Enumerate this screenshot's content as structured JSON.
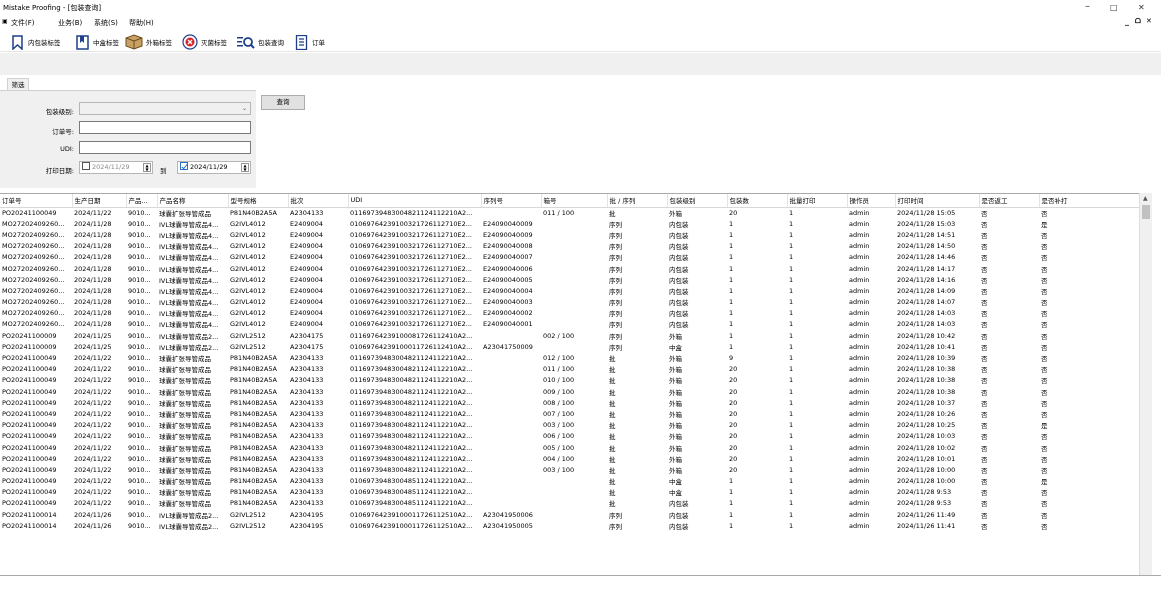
{
  "window": {
    "title": "Mistake Proofing - [包装查询]",
    "controls": [
      "–",
      "□",
      "✕"
    ],
    "mdi_controls": [
      "_",
      "ᗝ",
      "✕"
    ]
  },
  "menu": [
    "文件(F)",
    "业务(B)",
    "系统(S)",
    "帮助(H)"
  ],
  "toolbar": [
    {
      "label": "内包装标签",
      "icon": "bookmark-icon"
    },
    {
      "label": "中盒标签",
      "icon": "bookmark-filled-icon"
    },
    {
      "label": "外箱标签",
      "icon": "box-icon"
    },
    {
      "label": "灭菌标签",
      "icon": "sterilize-icon"
    },
    {
      "label": "包装查询",
      "icon": "search-icon"
    },
    {
      "label": "订单",
      "icon": "order-icon"
    }
  ],
  "filter": {
    "tab": "筛选",
    "level_label": "包装级别:",
    "level_value": "",
    "order_label": "订单号:",
    "order_value": "",
    "udi_label": "UDI:",
    "udi_value": "",
    "date_label": "打印日期:",
    "date_from": "2024/11/29",
    "date_to_sep": "到",
    "date_to": "2024/11/29",
    "query_button": "查询"
  },
  "columns": [
    "订单号",
    "生产日期",
    "产品...",
    "产品名称",
    "型号规格",
    "批次",
    "UDI",
    "序列号",
    "箱号",
    "批 / 序列",
    "包装级别",
    "包装数",
    "批量打印",
    "操作员",
    "打印时间",
    "是否返工",
    "是否补打"
  ],
  "rows": [
    [
      "PO20241100049",
      "2024/11/22",
      "9010...",
      "球囊扩张导管成品",
      "P81N40B2A5A",
      "A2304133",
      "01169739483004821124112210A2...",
      "",
      "011 / 100",
      "批",
      "外箱",
      "20",
      "1",
      "admin",
      "2024/11/28 15:05",
      "否",
      "否"
    ],
    [
      "MO27202409260...",
      "2024/11/28",
      "9010...",
      "IVL球囊导管成品4...",
      "G2IVL4012",
      "E2409004",
      "01069764239100321726112710E2...",
      "E24090040009",
      "",
      "序列",
      "内包装",
      "1",
      "1",
      "admin",
      "2024/11/28 15:03",
      "否",
      "是"
    ],
    [
      "MO27202409260...",
      "2024/11/28",
      "9010...",
      "IVL球囊导管成品4...",
      "G2IVL4012",
      "E2409004",
      "01069764239100321726112710E2...",
      "E24090040009",
      "",
      "序列",
      "内包装",
      "1",
      "1",
      "admin",
      "2024/11/28 14:51",
      "否",
      "否"
    ],
    [
      "MO27202409260...",
      "2024/11/28",
      "9010...",
      "IVL球囊导管成品4...",
      "G2IVL4012",
      "E2409004",
      "01069764239100321726112710E2...",
      "E24090040008",
      "",
      "序列",
      "内包装",
      "1",
      "1",
      "admin",
      "2024/11/28 14:50",
      "否",
      "否"
    ],
    [
      "MO27202409260...",
      "2024/11/28",
      "9010...",
      "IVL球囊导管成品4...",
      "G2IVL4012",
      "E2409004",
      "01069764239100321726112710E2...",
      "E24090040007",
      "",
      "序列",
      "内包装",
      "1",
      "1",
      "admin",
      "2024/11/28 14:46",
      "否",
      "否"
    ],
    [
      "MO27202409260...",
      "2024/11/28",
      "9010...",
      "IVL球囊导管成品4...",
      "G2IVL4012",
      "E2409004",
      "01069764239100321726112710E2...",
      "E24090040006",
      "",
      "序列",
      "内包装",
      "1",
      "1",
      "admin",
      "2024/11/28 14:17",
      "否",
      "否"
    ],
    [
      "MO27202409260...",
      "2024/11/28",
      "9010...",
      "IVL球囊导管成品4...",
      "G2IVL4012",
      "E2409004",
      "01069764239100321726112710E2...",
      "E24090040005",
      "",
      "序列",
      "内包装",
      "1",
      "1",
      "admin",
      "2024/11/28 14:16",
      "否",
      "否"
    ],
    [
      "MO27202409260...",
      "2024/11/28",
      "9010...",
      "IVL球囊导管成品4...",
      "G2IVL4012",
      "E2409004",
      "01069764239100321726112710E2...",
      "E24090040004",
      "",
      "序列",
      "内包装",
      "1",
      "1",
      "admin",
      "2024/11/28 14:09",
      "否",
      "否"
    ],
    [
      "MO27202409260...",
      "2024/11/28",
      "9010...",
      "IVL球囊导管成品4...",
      "G2IVL4012",
      "E2409004",
      "01069764239100321726112710E2...",
      "E24090040003",
      "",
      "序列",
      "内包装",
      "1",
      "1",
      "admin",
      "2024/11/28 14:07",
      "否",
      "否"
    ],
    [
      "MO27202409260...",
      "2024/11/28",
      "9010...",
      "IVL球囊导管成品4...",
      "G2IVL4012",
      "E2409004",
      "01069764239100321726112710E2...",
      "E24090040002",
      "",
      "序列",
      "内包装",
      "1",
      "1",
      "admin",
      "2024/11/28 14:03",
      "否",
      "否"
    ],
    [
      "MO27202409260...",
      "2024/11/28",
      "9010...",
      "IVL球囊导管成品4...",
      "G2IVL4012",
      "E2409004",
      "01069764239100321726112710E2...",
      "E24090040001",
      "",
      "序列",
      "内包装",
      "1",
      "1",
      "admin",
      "2024/11/28 14:03",
      "否",
      "否"
    ],
    [
      "PO20241100009",
      "2024/11/25",
      "9010...",
      "IVL球囊导管成品2...",
      "G2IVL2512",
      "A2304175",
      "01169764239100081726112410A2...",
      "",
      "002 / 100",
      "序列",
      "外箱",
      "1",
      "1",
      "admin",
      "2024/11/28 10:42",
      "否",
      "否"
    ],
    [
      "PO20241100009",
      "2024/11/25",
      "9010...",
      "IVL球囊导管成品2...",
      "G2IVL2512",
      "A2304175",
      "01069764239100011726112410A2...",
      "A23041750009",
      "",
      "序列",
      "中盒",
      "1",
      "1",
      "admin",
      "2024/11/28 10:41",
      "否",
      "否"
    ],
    [
      "PO20241100049",
      "2024/11/22",
      "9010...",
      "球囊扩张导管成品",
      "P81N40B2A5A",
      "A2304133",
      "01169739483004821124112210A2...",
      "",
      "012 / 100",
      "批",
      "外箱",
      "9",
      "1",
      "admin",
      "2024/11/28 10:39",
      "否",
      "否"
    ],
    [
      "PO20241100049",
      "2024/11/22",
      "9010...",
      "球囊扩张导管成品",
      "P81N40B2A5A",
      "A2304133",
      "01169739483004821124112210A2...",
      "",
      "011 / 100",
      "批",
      "外箱",
      "20",
      "1",
      "admin",
      "2024/11/28 10:38",
      "否",
      "否"
    ],
    [
      "PO20241100049",
      "2024/11/22",
      "9010...",
      "球囊扩张导管成品",
      "P81N40B2A5A",
      "A2304133",
      "01169739483004821124112210A2...",
      "",
      "010 / 100",
      "批",
      "外箱",
      "20",
      "1",
      "admin",
      "2024/11/28 10:38",
      "否",
      "否"
    ],
    [
      "PO20241100049",
      "2024/11/22",
      "9010...",
      "球囊扩张导管成品",
      "P81N40B2A5A",
      "A2304133",
      "01169739483004821124112210A2...",
      "",
      "009 / 100",
      "批",
      "外箱",
      "20",
      "1",
      "admin",
      "2024/11/28 10:38",
      "否",
      "否"
    ],
    [
      "PO20241100049",
      "2024/11/22",
      "9010...",
      "球囊扩张导管成品",
      "P81N40B2A5A",
      "A2304133",
      "01169739483004821124112210A2...",
      "",
      "008 / 100",
      "批",
      "外箱",
      "20",
      "1",
      "admin",
      "2024/11/28 10:37",
      "否",
      "否"
    ],
    [
      "PO20241100049",
      "2024/11/22",
      "9010...",
      "球囊扩张导管成品",
      "P81N40B2A5A",
      "A2304133",
      "01169739483004821124112210A2...",
      "",
      "007 / 100",
      "批",
      "外箱",
      "20",
      "1",
      "admin",
      "2024/11/28 10:26",
      "否",
      "否"
    ],
    [
      "PO20241100049",
      "2024/11/22",
      "9010...",
      "球囊扩张导管成品",
      "P81N40B2A5A",
      "A2304133",
      "01169739483004821124112210A2...",
      "",
      "003 / 100",
      "批",
      "外箱",
      "20",
      "1",
      "admin",
      "2024/11/28 10:25",
      "否",
      "是"
    ],
    [
      "PO20241100049",
      "2024/11/22",
      "9010...",
      "球囊扩张导管成品",
      "P81N40B2A5A",
      "A2304133",
      "01169739483004821124112210A2...",
      "",
      "006 / 100",
      "批",
      "外箱",
      "20",
      "1",
      "admin",
      "2024/11/28 10:03",
      "否",
      "否"
    ],
    [
      "PO20241100049",
      "2024/11/22",
      "9010...",
      "球囊扩张导管成品",
      "P81N40B2A5A",
      "A2304133",
      "01169739483004821124112210A2...",
      "",
      "005 / 100",
      "批",
      "外箱",
      "20",
      "1",
      "admin",
      "2024/11/28 10:02",
      "否",
      "否"
    ],
    [
      "PO20241100049",
      "2024/11/22",
      "9010...",
      "球囊扩张导管成品",
      "P81N40B2A5A",
      "A2304133",
      "01169739483004821124112210A2...",
      "",
      "004 / 100",
      "批",
      "外箱",
      "20",
      "1",
      "admin",
      "2024/11/28 10:01",
      "否",
      "否"
    ],
    [
      "PO20241100049",
      "2024/11/22",
      "9010...",
      "球囊扩张导管成品",
      "P81N40B2A5A",
      "A2304133",
      "01169739483004821124112210A2...",
      "",
      "003 / 100",
      "批",
      "外箱",
      "20",
      "1",
      "admin",
      "2024/11/28 10:00",
      "否",
      "否"
    ],
    [
      "PO20241100049",
      "2024/11/22",
      "9010...",
      "球囊扩张导管成品",
      "P81N40B2A5A",
      "A2304133",
      "01069739483004851124112210A2...",
      "",
      "",
      "批",
      "中盒",
      "1",
      "1",
      "admin",
      "2024/11/28 10:00",
      "否",
      "是"
    ],
    [
      "PO20241100049",
      "2024/11/22",
      "9010...",
      "球囊扩张导管成品",
      "P81N40B2A5A",
      "A2304133",
      "01069739483004851124112210A2...",
      "",
      "",
      "批",
      "中盒",
      "1",
      "1",
      "admin",
      "2024/11/28 9:53",
      "否",
      "否"
    ],
    [
      "PO20241100049",
      "2024/11/22",
      "9010...",
      "球囊扩张导管成品",
      "P81N40B2A5A",
      "A2304133",
      "01069739483004851124112210A2...",
      "",
      "",
      "批",
      "内包装",
      "1",
      "1",
      "admin",
      "2024/11/28 9:53",
      "否",
      "否"
    ],
    [
      "PO20241100014",
      "2024/11/26",
      "9010...",
      "IVL球囊导管成品2...",
      "G2IVL2512",
      "A2304195",
      "01069764239100011726112510A2...",
      "A23041950006",
      "",
      "序列",
      "内包装",
      "1",
      "1",
      "admin",
      "2024/11/26 11:49",
      "否",
      "否"
    ],
    [
      "PO20241100014",
      "2024/11/26",
      "9010...",
      "IVL球囊导管成品2...",
      "G2IVL2512",
      "A2304195",
      "01069764239100011726112510A2...",
      "A23041950005",
      "",
      "序列",
      "内包装",
      "1",
      "1",
      "admin",
      "2024/11/26 11:41",
      "否",
      "否"
    ]
  ]
}
